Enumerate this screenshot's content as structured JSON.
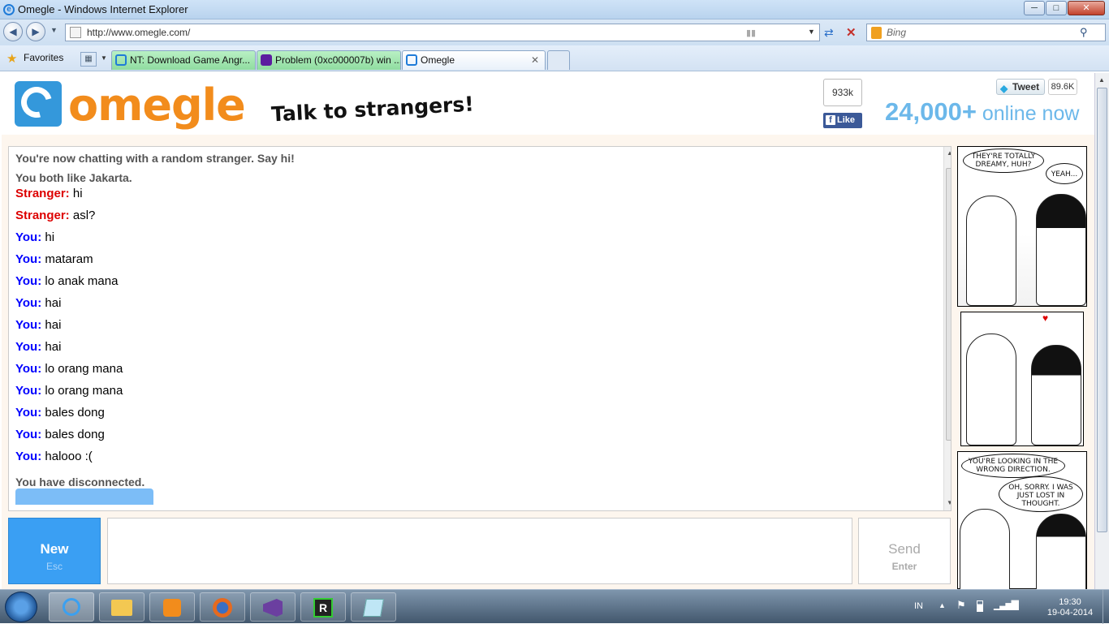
{
  "window": {
    "title": "Omegle - Windows Internet Explorer",
    "min": "─",
    "max": "□",
    "close": "✕"
  },
  "nav": {
    "url": "http://www.omegle.com/",
    "search_placeholder": "Bing"
  },
  "favorites": {
    "label": "Favorites"
  },
  "tabs": [
    {
      "label": "NT: Download Game Angr..."
    },
    {
      "label": "Problem (0xc000007b) win ..."
    },
    {
      "label": "Omegle"
    }
  ],
  "header": {
    "logo": "omegle",
    "tagline": "Talk to strangers!",
    "fb_count": "933k",
    "fb_like": "Like",
    "tweet": "Tweet",
    "tweet_count": "89.6K",
    "online_number": "24,000+",
    "online_label": " online now"
  },
  "chat": {
    "intro": "You're now chatting with a random stranger. Say hi!",
    "common": "You both like Jakarta.",
    "messages": [
      {
        "who": "Stranger:",
        "text": " hi"
      },
      {
        "who": "Stranger:",
        "text": " asl?"
      },
      {
        "who": "You:",
        "text": " hi"
      },
      {
        "who": "You:",
        "text": " mataram"
      },
      {
        "who": "You:",
        "text": " lo anak mana"
      },
      {
        "who": "You:",
        "text": " hai"
      },
      {
        "who": "You:",
        "text": " hai"
      },
      {
        "who": "You:",
        "text": " hai"
      },
      {
        "who": "You:",
        "text": " lo orang mana"
      },
      {
        "who": "You:",
        "text": " lo orang mana"
      },
      {
        "who": "You:",
        "text": " bales dong"
      },
      {
        "who": "You:",
        "text": " bales dong"
      },
      {
        "who": "You:",
        "text": " halooo :("
      }
    ],
    "disconnected": "You have disconnected."
  },
  "controls": {
    "new_label": "New",
    "new_key": "Esc",
    "send_label": "Send",
    "send_key": "Enter"
  },
  "comic": {
    "p1_b1": "THEY'RE TOTALLY DREAMY, HUH?",
    "p1_b2": "YEAH...",
    "p3_b1": "YOU'RE LOOKING IN THE WRONG DIRECTION.",
    "p3_b2": "OH, SORRY. I WAS JUST LOST IN THOUGHT."
  },
  "taskbar": {
    "lang": "IN",
    "time": "19:30",
    "date": "19-04-2014"
  },
  "colors": {
    "stranger": "#dd0000",
    "you": "#0000ff",
    "accent": "#3a9ff3",
    "logo": "#f28c1c"
  }
}
